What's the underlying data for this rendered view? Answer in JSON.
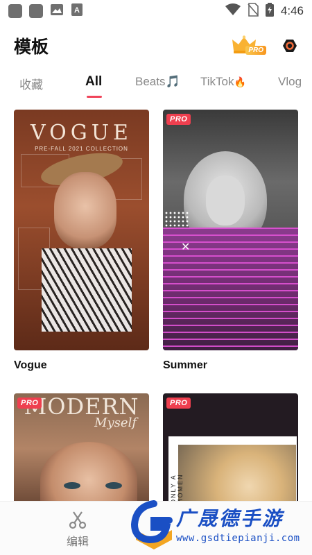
{
  "status_bar": {
    "time": "4:46",
    "icons": [
      "app-icon",
      "app-icon",
      "image-icon",
      "font-icon",
      "wifi-icon",
      "no-sim-icon",
      "battery-charging-icon"
    ]
  },
  "header": {
    "title": "模板",
    "pro_tag": "PRO",
    "pro_icon": "crown-icon",
    "settings_icon": "settings-icon"
  },
  "tabs": [
    {
      "label": "收藏",
      "active": false
    },
    {
      "label": "All",
      "active": true
    },
    {
      "label": "Beats",
      "emoji": "🎵",
      "active": false
    },
    {
      "label": "TikTok",
      "emoji": "🔥",
      "active": false
    },
    {
      "label": "Vlog",
      "active": false
    }
  ],
  "templates": [
    {
      "name": "Vogue",
      "pro": false,
      "art_title": "VOGUE",
      "art_subtitle": "PRE-FALL 2021 COLLECTION"
    },
    {
      "name": "Summer",
      "pro": true,
      "badge": "PRO"
    },
    {
      "pro": true,
      "badge": "PRO",
      "art_title": "MODERN",
      "art_script": "Myself"
    },
    {
      "pro": true,
      "badge": "PRO",
      "art_vertical_text": "ONLY A MOMEN"
    }
  ],
  "bottom_nav": {
    "edit_label": "编辑",
    "edit_icon": "scissors-icon"
  },
  "watermark": {
    "text": "广晟德手游",
    "url": "www.gsdtiepianji.com"
  },
  "colors": {
    "accent": "#f0445a",
    "pro_badge": "#ef3f4f",
    "watermark_blue": "#1a4fc4"
  }
}
